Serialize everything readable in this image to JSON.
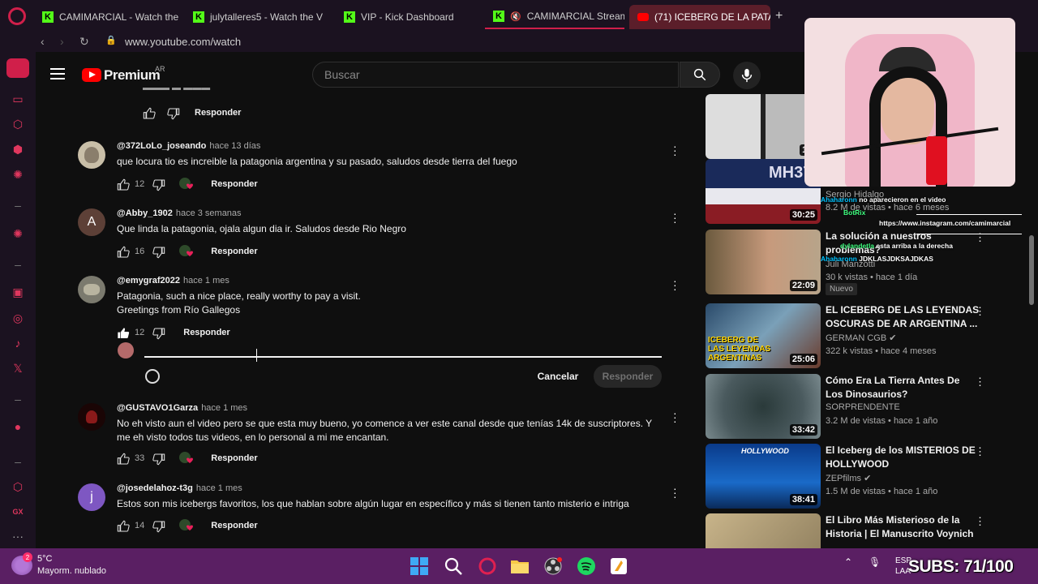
{
  "browser": {
    "tabs": [
      {
        "label": "CAMIMARCIAL - Watch the",
        "icon": "kick-icon"
      },
      {
        "label": "julytalleres5 - Watch the V",
        "icon": "kick-icon"
      },
      {
        "label": "VIP - Kick Dashboard",
        "icon": "kick-icon"
      },
      {
        "label": "CAMIMARCIAL Stream",
        "icon": "kick-icon"
      },
      {
        "label": "(71) ICEBERG DE LA PATAGO",
        "icon": "youtube-icon"
      }
    ],
    "url": "www.youtube.com/watch",
    "accent": "#d01f4a"
  },
  "youtube": {
    "brand": "Premium",
    "region": "AR",
    "search_placeholder": "Buscar"
  },
  "comments": {
    "previous_reply_label": "Responder",
    "items": [
      {
        "user": "@372LoLo_joseando",
        "time": "hace 13 días",
        "text": "que locura tio es increible la patagonia argentina y su pasado, saludos desde tierra del fuego",
        "likes": "12",
        "reply": "Responder"
      },
      {
        "user": "@Abby_1902",
        "time": "hace 3 semanas",
        "text": "Que linda la patagonia, ojala algun dia ir. Saludos desde Rio Negro",
        "likes": "16",
        "reply": "Responder",
        "avatar_letter": "A"
      },
      {
        "user": "@emygraf2022",
        "time": "hace 1 mes",
        "text": "Patagonia, such a nice place, really worthy to pay a visit.",
        "text2": "Greetings from Río Gallegos",
        "likes": "12",
        "reply": "Responder"
      },
      {
        "user": "@GUSTAVO1Garza",
        "time": "hace 1 mes",
        "text": "No eh visto aun el video pero se que esta muy bueno, yo comence a ver este canal desde que tenías 14k de suscriptores. Y me eh visto todos tus videos, en lo personal a mi me encantan.",
        "likes": "33",
        "reply": "Responder"
      },
      {
        "user": "@josedelahoz-t3g",
        "time": "hace 1 mes",
        "text": "Estos son mis icebergs favoritos, los que hablan sobre algún lugar en específico y más si tienen tanto misterio e intriga",
        "likes": "14",
        "reply": "Responder",
        "avatar_letter": "j"
      }
    ],
    "reply_box": {
      "cancel": "Cancelar",
      "submit": "Responder"
    }
  },
  "sidebar_videos": [
    {
      "title": "",
      "channel": "",
      "meta": "",
      "duration": "19:"
    },
    {
      "title": "",
      "channel": "Sergio Hidalgo",
      "meta": "8.2 M de vistas • hace 6 meses",
      "duration": "30:25"
    },
    {
      "title": "La solución a nuestros problemas?",
      "channel": "Juli Manzotti",
      "meta": "30 k vistas • hace 1 día",
      "duration": "22:09",
      "badge": "Nuevo"
    },
    {
      "title": "EL ICEBERG DE LAS LEYENDAS OSCURAS DE AR ARGENTINA ...",
      "channel": "GERMAN CGB",
      "meta": "322 k vistas • hace 4 meses",
      "duration": "25:06",
      "thumb_text": "ICEBERG DE LAS LEYENDAS ARGENTINAS"
    },
    {
      "title": "Cómo Era La Tierra Antes De Los Dinosaurios?",
      "channel": "SORPRENDENTE",
      "meta": "3.2 M de vistas • hace 1 año",
      "duration": "33:42"
    },
    {
      "title": "El Iceberg de los MISTERIOS DE HOLLYWOOD",
      "channel": "ZEPfilms",
      "meta": "1.5 M de vistas • hace 1 año",
      "duration": "38:41",
      "thumb_text": "HOLLYWOOD"
    },
    {
      "title": "El Libro Más Misterioso de la Historia | El Manuscrito Voynich",
      "channel": "",
      "meta": "",
      "duration": ""
    }
  ],
  "stream_overlay": {
    "chat": [
      {
        "name": "Ahaharonn",
        "text": "no aparecieron en el video"
      },
      {
        "name": "BotRix",
        "text": ""
      },
      {
        "name": "",
        "text": "https://www.instagram.com/camimarcial"
      },
      {
        "name": "dylandetla",
        "text": "esta arriba a la derecha"
      },
      {
        "name": "Ahaharonn",
        "text": "JDKLASJDKSAJDKAS"
      }
    ],
    "subs": "SUBS: 71/100"
  },
  "taskbar": {
    "temp": "5°C",
    "weather": "Mayorm. nublado",
    "weather_badge": "2",
    "lang": "ESP",
    "lang2": "LAA",
    "color": "#5a1f63"
  }
}
